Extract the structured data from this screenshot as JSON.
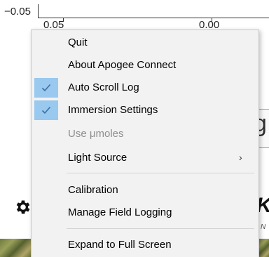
{
  "background": {
    "y_tick_label": "−0.05",
    "x_tick_labels": [
      "0.05",
      "0.00"
    ],
    "partial_box_letter": "g",
    "brand_partial": "K",
    "brand_sub_partial": "N",
    "gear_icon": "gear-icon"
  },
  "menu": {
    "items": [
      {
        "label": "Quit",
        "checked": false,
        "disabled": false
      },
      {
        "label": "About Apogee Connect",
        "checked": false,
        "disabled": false
      },
      {
        "label": "Auto Scroll Log",
        "checked": true,
        "disabled": false
      },
      {
        "label": "Immersion Settings",
        "checked": true,
        "disabled": false
      },
      {
        "label": "Use μmoles",
        "checked": false,
        "disabled": true
      },
      {
        "label": "Light Source",
        "checked": false,
        "disabled": false,
        "submenu": true
      },
      {
        "label": "Calibration",
        "checked": false,
        "disabled": false
      },
      {
        "label": "Manage Field Logging",
        "checked": false,
        "disabled": false
      },
      {
        "label": "Expand to Full Screen",
        "checked": false,
        "disabled": false
      }
    ],
    "submenu_arrow": "›",
    "check_color": "#3c6fa3",
    "highlight_color": "#99c9ef"
  }
}
